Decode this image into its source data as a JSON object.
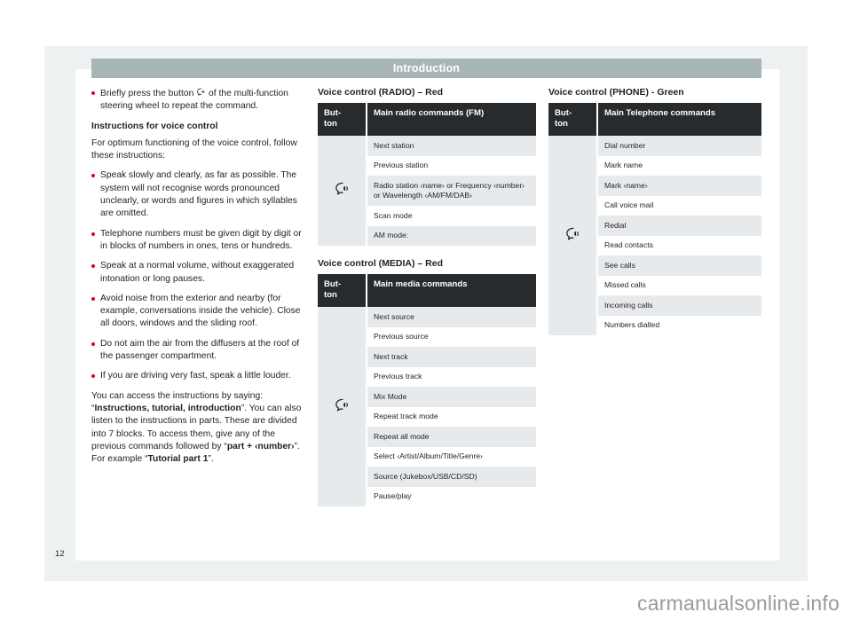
{
  "header": {
    "title": "Introduction"
  },
  "page_number": "12",
  "watermark": "carmanualsonline.info",
  "icons": {
    "voice_button": "voice-control-button-icon"
  },
  "left_column": {
    "bullet_1": {
      "before_icon": "Briefly press the button ",
      "after_icon": " of the multi-function steering wheel to repeat the command."
    },
    "section_heading": "Instructions for voice control",
    "intro_paragraph": "For optimum functioning of the voice control, follow these instructions:",
    "bullets": [
      "Speak slowly and clearly, as far as possible. The system will not recognise words pronounced unclearly, or words and figures in which syllables are omitted.",
      "Telephone numbers must be given digit by digit or in blocks of numbers in ones, tens or hundreds.",
      "Speak at a normal volume, without exaggerated intonation or long pauses.",
      "Avoid noise from the exterior and nearby (for example, conversations inside the vehicle). Close all doors, windows and the sliding roof.",
      "Do not aim the air from the diffusers at the roof of the passenger compartment.",
      "If you are driving very fast, speak a little louder."
    ],
    "closing_paragraph": {
      "part_1": "You can access the instructions by saying: “",
      "bold_1": "Instructions, tutorial, introduction",
      "part_2": "”. You can also listen to the instructions in parts. These are divided into 7 blocks. To access them, give any of the previous commands followed by “",
      "bold_2": "part + ‹number›",
      "part_3": "”. For example “",
      "bold_3": "Tutorial part 1",
      "part_4": "”."
    }
  },
  "tables": {
    "radio": {
      "caption": "Voice control (RADIO) – Red",
      "header_button": "But-\nton",
      "header_commands": "Main radio commands (FM)",
      "rows": [
        "Next station",
        "Previous station",
        "Radio station ‹name› or Frequency ‹number› or Wavelength ‹AM/FM/DAB›",
        "Scan mode",
        "AM mode:"
      ]
    },
    "media": {
      "caption": "Voice control (MEDIA) – Red",
      "header_button": "But-\nton",
      "header_commands": "Main media commands",
      "rows": [
        "Next source",
        "Previous source",
        "Next track",
        "Previous track",
        "Mix Mode",
        "Repeat track mode",
        "Repeat all mode",
        "Select ‹Artist/Album/Title/Genre›",
        "Source (Jukebox/USB/CD/SD)",
        "Pause/play"
      ]
    },
    "phone": {
      "caption": "Voice control (PHONE) - Green",
      "header_button": "But-\nton",
      "header_commands": "Main Telephone commands",
      "rows": [
        "Dial number",
        "Mark name",
        "Mark ‹name›",
        "Call voice mail",
        "Redial",
        "Read contacts",
        "See calls",
        "Missed calls",
        "Incoming calls",
        "Numbers dialled"
      ]
    }
  },
  "colors": {
    "header_band": "#a7b5b6",
    "table_header": "#272b2d",
    "row_alt": "#e7eaec",
    "bullet": "#e3001b",
    "page_frame": "#eef1f2"
  }
}
